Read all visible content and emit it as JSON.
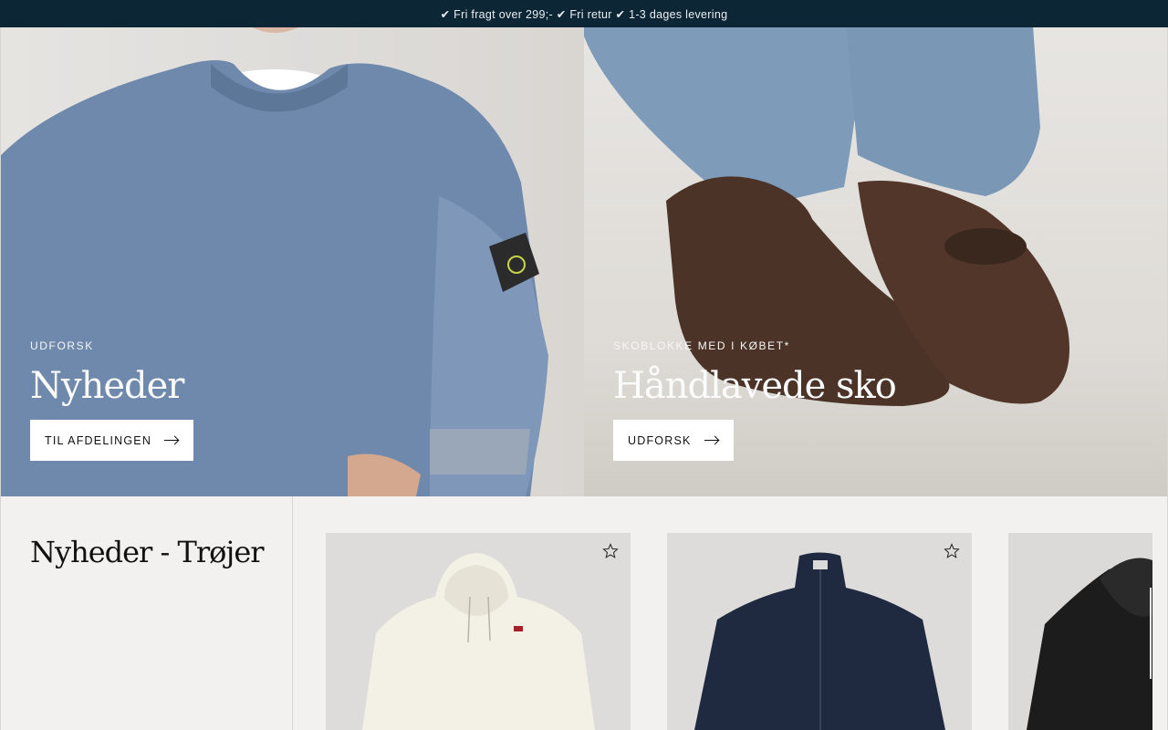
{
  "topbar": {
    "text": "✔ Fri fragt over 299;- ✔ Fri retur ✔ 1-3 dages levering"
  },
  "hero_left": {
    "eyebrow": "UDFORSK",
    "title": "Nyheder",
    "button_label": "TIL AFDELINGEN"
  },
  "hero_right": {
    "eyebrow": "SKOBLOKKE MED I KØBET*",
    "title": "Håndlavede sko",
    "button_label": "UDFORSK"
  },
  "section": {
    "title": "Nyheder - Trøjer"
  },
  "products": [
    {
      "image": "cream-hoodie",
      "favorite_icon": "star-outline-icon"
    },
    {
      "image": "navy-zip-cardigan",
      "favorite_icon": "star-outline-icon"
    },
    {
      "image": "black-hoodie"
    }
  ],
  "colors": {
    "topbar_bg": "#0d2636",
    "page_bg": "#f2f1ef"
  }
}
